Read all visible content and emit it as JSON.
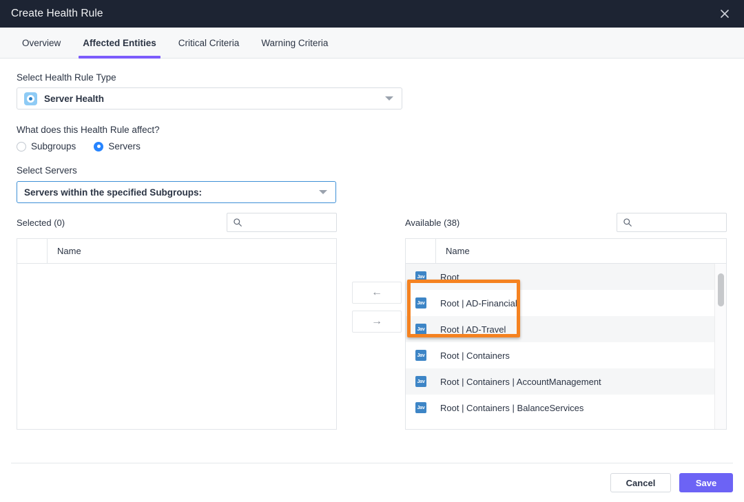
{
  "window": {
    "title": "Create Health Rule",
    "close_icon": "close-icon"
  },
  "tabs": [
    {
      "label": "Overview",
      "active": false
    },
    {
      "label": "Affected Entities",
      "active": true
    },
    {
      "label": "Critical Criteria",
      "active": false
    },
    {
      "label": "Warning Criteria",
      "active": false
    }
  ],
  "form": {
    "rule_type_label": "Select Health Rule Type",
    "rule_type_value": "Server Health",
    "rule_type_icon": "server-health-icon",
    "affect_question": "What does this Health Rule affect?",
    "radios": [
      {
        "label": "Subgroups",
        "checked": false
      },
      {
        "label": "Servers",
        "checked": true
      }
    ],
    "select_servers_label": "Select Servers",
    "scope_value": "Servers within the specified Subgroups:"
  },
  "selected_panel": {
    "title": "Selected (0)",
    "search_placeholder": "",
    "search_value": "",
    "column_header": "Name",
    "rows": []
  },
  "available_panel": {
    "title": "Available (38)",
    "search_placeholder": "",
    "search_value": "",
    "column_header": "Name",
    "rows": [
      {
        "icon": "java-icon",
        "name": "Root"
      },
      {
        "icon": "java-icon",
        "name": "Root | AD-Financial"
      },
      {
        "icon": "java-icon",
        "name": "Root | AD-Travel"
      },
      {
        "icon": "java-icon",
        "name": "Root | Containers"
      },
      {
        "icon": "java-icon",
        "name": "Root | Containers | AccountManagement"
      },
      {
        "icon": "java-icon",
        "name": "Root | Containers | BalanceServices"
      }
    ]
  },
  "transfer": {
    "move_left_label": "←",
    "move_right_label": "→"
  },
  "footer": {
    "cancel_label": "Cancel",
    "save_label": "Save"
  },
  "colors": {
    "titlebar": "#1d2433",
    "tab_accent": "#7c5cfc",
    "save_button": "#6c63f5",
    "radio_checked": "#2684ff",
    "annotation": "#f58220",
    "java_icon": "#3d85c6",
    "focus_border": "#3d8fd6"
  }
}
